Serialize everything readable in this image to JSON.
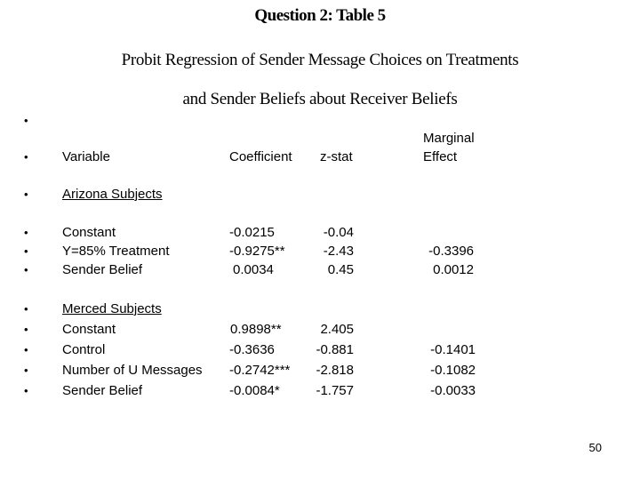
{
  "title": "Question 2: Table 5",
  "subtitle_line1": "Probit Regression of Sender Message Choices on Treatments",
  "subtitle_line2": "and Sender Beliefs about Receiver Beliefs",
  "bullet_glyph": "•",
  "table": {
    "headers": {
      "variable": "Variable",
      "coefficient": "Coefficient",
      "zstat": "z-stat",
      "marginal_line1": "Marginal",
      "marginal_line2": "Effect"
    },
    "groups": [
      {
        "name": "Arizona Subjects",
        "rows": [
          {
            "variable": "Constant",
            "coefficient": "-0.0215",
            "zstat": "-0.04",
            "marginal": ""
          },
          {
            "variable": "Y=85% Treatment",
            "coefficient": "-0.9275**",
            "zstat": "-2.43",
            "marginal": "-0.3396"
          },
          {
            "variable": "Sender Belief",
            "coefficient": "0.0034",
            "zstat": "0.45",
            "marginal": "0.0012"
          }
        ]
      },
      {
        "name": "Merced Subjects",
        "rows": [
          {
            "variable": "Constant",
            "coefficient": "0.9898**",
            "zstat": "2.405",
            "marginal": ""
          },
          {
            "variable": "Control",
            "coefficient": "-0.3636",
            "zstat": "-0.881",
            "marginal": "-0.1401"
          },
          {
            "variable": "Number of U Messages",
            "coefficient": "-0.2742***",
            "zstat": "-2.818",
            "marginal": "-0.1082"
          },
          {
            "variable": "Sender Belief",
            "coefficient": "-0.0084*",
            "zstat": "-1.757",
            "marginal": "-0.0033"
          }
        ]
      }
    ]
  },
  "page_number": "50"
}
